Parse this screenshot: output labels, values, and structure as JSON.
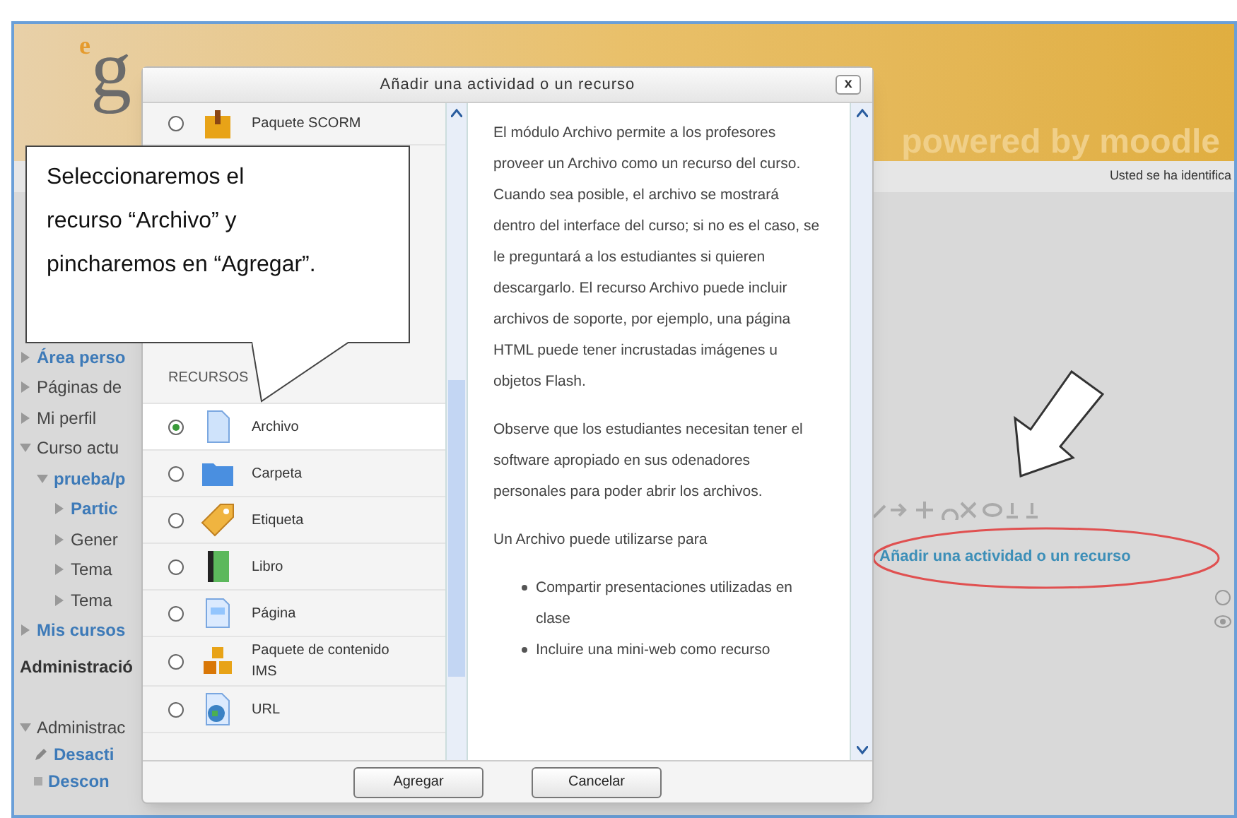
{
  "page": {
    "logo": {
      "small": "e",
      "large": "g"
    },
    "powered_by": "powered by moodle",
    "login_info": "Usted se ha identifica",
    "sidebar": {
      "items": [
        {
          "label": "Área perso",
          "link": true,
          "expanded": false
        },
        {
          "label": "Páginas de",
          "link": false,
          "expanded": false
        },
        {
          "label": "Mi perfil",
          "link": false,
          "expanded": false
        },
        {
          "label": "Curso actu",
          "link": false,
          "expanded": true,
          "children": [
            {
              "label": "prueba/p",
              "link": true,
              "expanded": true,
              "children": [
                {
                  "label": "Partic",
                  "link": true,
                  "expanded": false
                },
                {
                  "label": "Gener",
                  "link": false,
                  "expanded": false
                },
                {
                  "label": "Tema",
                  "link": false,
                  "expanded": false
                },
                {
                  "label": "Tema",
                  "link": false,
                  "expanded": false
                }
              ]
            }
          ]
        },
        {
          "label": "Mis cursos",
          "link": true,
          "expanded": false
        }
      ],
      "admin_heading": "Administració",
      "admin_items": [
        {
          "label": "Administrac",
          "kind": "folder"
        },
        {
          "label": "Desacti",
          "kind": "edit"
        },
        {
          "label": "Descon",
          "kind": "bullet"
        }
      ]
    },
    "add_link": "Añadir una actividad o un recurso"
  },
  "dialog": {
    "title": "Añadir una actividad o un recurso",
    "close": "x",
    "options": [
      {
        "kind": "option",
        "label": "Paquete SCORM",
        "selected": false
      },
      {
        "kind": "header",
        "label": "RECURSOS"
      },
      {
        "kind": "option",
        "label": "Archivo",
        "selected": true
      },
      {
        "kind": "option",
        "label": "Carpeta",
        "selected": false
      },
      {
        "kind": "option",
        "label": "Etiqueta",
        "selected": false
      },
      {
        "kind": "option",
        "label": "Libro",
        "selected": false
      },
      {
        "kind": "option",
        "label": "Página",
        "selected": false
      },
      {
        "kind": "option",
        "label": "Paquete de contenido IMS",
        "selected": false
      },
      {
        "kind": "option",
        "label": "URL",
        "selected": false
      }
    ],
    "description": [
      "El módulo Archivo permite a los profesores proveer un Archivo como un recurso del curso. Cuando sea posible, el archivo se mostrará dentro del interface del curso; si no es el caso, se le preguntará a los estudiantes si quieren descargarlo. El recurso Archivo puede incluir archivos de soporte, por ejemplo, una página HTML puede tener incrustadas imágenes u objetos Flash.",
      "Observe que los estudiantes necesitan tener el software apropiado en sus odenadores personales para poder abrir los archivos.",
      "Un Archivo puede utilizarse para"
    ],
    "bullets": [
      "Compartir presentaciones utilizadas en clase",
      "Incluire una mini-web como recurso"
    ],
    "buttons": [
      "Agregar",
      "Cancelar"
    ]
  },
  "callout": "Seleccionaremos el recurso “Archivo” y pincharemos en “Agregar”."
}
